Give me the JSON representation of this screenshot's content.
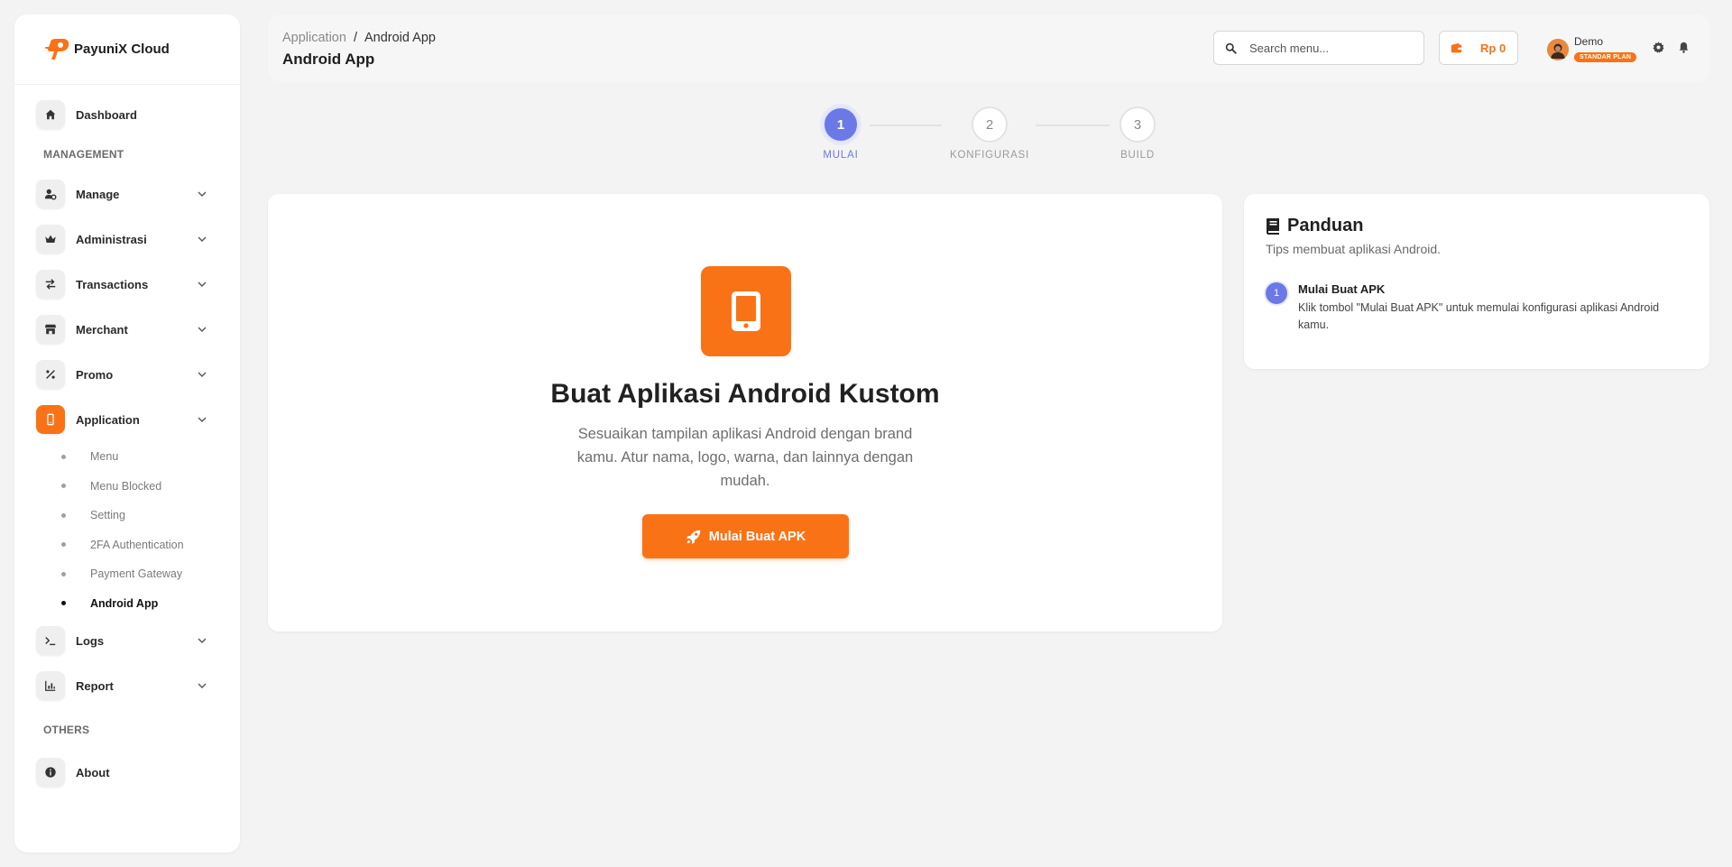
{
  "brand": {
    "name": "PayuniX Cloud"
  },
  "sidebar": {
    "dashboard": "Dashboard",
    "section_management": "MANAGEMENT",
    "items": [
      {
        "label": "Manage",
        "icon": "user-gear-icon"
      },
      {
        "label": "Administrasi",
        "icon": "crown-icon"
      },
      {
        "label": "Transactions",
        "icon": "exchange-icon"
      },
      {
        "label": "Merchant",
        "icon": "store-icon"
      },
      {
        "label": "Promo",
        "icon": "percent-icon"
      },
      {
        "label": "Application",
        "icon": "mobile-icon"
      }
    ],
    "application_sub": [
      "Menu",
      "Menu Blocked",
      "Setting",
      "2FA Authentication",
      "Payment Gateway",
      "Android App"
    ],
    "items_after": [
      {
        "label": "Logs",
        "icon": "terminal-icon"
      },
      {
        "label": "Report",
        "icon": "chart-icon"
      }
    ],
    "section_others": "OTHERS",
    "about": "About"
  },
  "header": {
    "breadcrumb_parent": "Application",
    "breadcrumb_separator": "/",
    "breadcrumb_current": "Android App",
    "title": "Android App",
    "search_placeholder": "Search menu...",
    "balance": "Rp 0",
    "user_name": "Demo",
    "plan_badge": "STANDAR PLAN"
  },
  "stepper": {
    "steps": [
      {
        "number": "1",
        "label": "MULAI",
        "active": true
      },
      {
        "number": "2",
        "label": "KONFIGURASI",
        "active": false
      },
      {
        "number": "3",
        "label": "BUILD",
        "active": false
      }
    ]
  },
  "main": {
    "title": "Buat Aplikasi Android Kustom",
    "description": "Sesuaikan tampilan aplikasi Android dengan brand kamu. Atur nama, logo, warna, dan lainnya dengan mudah.",
    "cta_label": "Mulai Buat APK"
  },
  "guide": {
    "title": "Panduan",
    "subtitle": "Tips membuat aplikasi Android.",
    "tips": [
      {
        "number": "1",
        "title": "Mulai Buat APK",
        "body": "Klik tombol \"Mulai Buat APK\" untuk memulai konfigurasi aplikasi Android kamu."
      }
    ]
  },
  "colors": {
    "accent": "#f97316",
    "step_active": "#6b79e6"
  }
}
